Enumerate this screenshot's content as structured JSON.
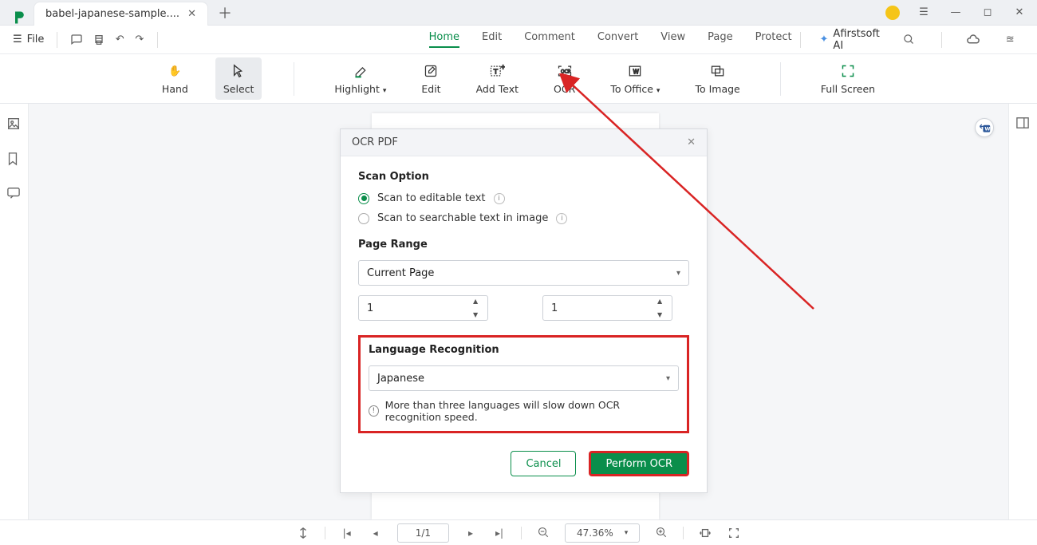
{
  "window": {
    "tab_title": "babel-japanese-sample....",
    "file_label": "File"
  },
  "menu": {
    "tabs": [
      "Home",
      "Edit",
      "Comment",
      "Convert",
      "View",
      "Page",
      "Protect"
    ],
    "ai_label": "Afirstsoft AI"
  },
  "toolbar": {
    "hand": "Hand",
    "select": "Select",
    "highlight": "Highlight",
    "edit": "Edit",
    "add_text": "Add Text",
    "ocr": "OCR",
    "to_office": "To Office",
    "to_image": "To Image",
    "full_screen": "Full Screen"
  },
  "dialog": {
    "title": "OCR PDF",
    "scan_option_label": "Scan Option",
    "radio1": "Scan to editable text",
    "radio2": "Scan to searchable text in image",
    "page_range_label": "Page Range",
    "page_range_value": "Current Page",
    "from_page": "1",
    "to_page": "1",
    "lang_label": "Language Recognition",
    "lang_value": "Japanese",
    "lang_warning": "More than three languages will slow down OCR recognition speed.",
    "cancel": "Cancel",
    "primary": "Perform OCR"
  },
  "status": {
    "page": "1/1",
    "zoom": "47.36%"
  }
}
